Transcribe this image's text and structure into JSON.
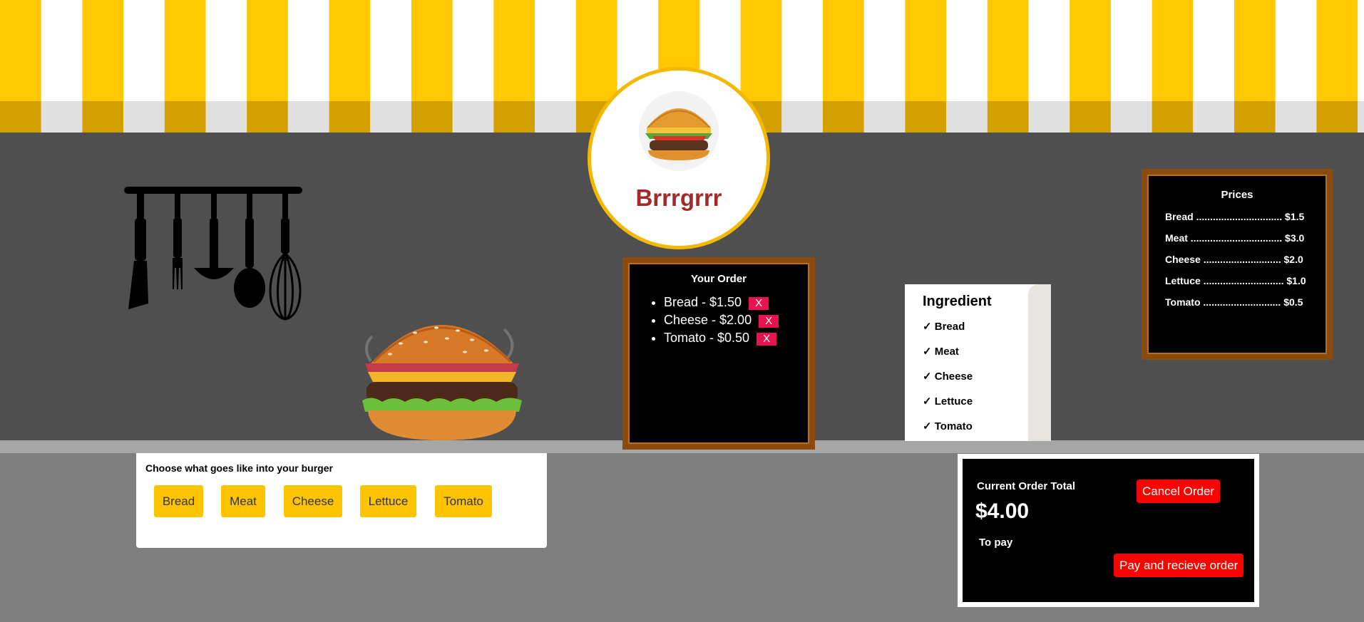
{
  "colors": {
    "awning_yellow": "#ffc800",
    "awning_dark": "#d4a000",
    "accent_red": "#ff0000",
    "frame_brown": "#8b4a0e",
    "button_yellow": "#ffc400"
  },
  "logo": {
    "name": "Brrrgrrr",
    "icon": "burger-icon"
  },
  "order_board": {
    "title": "Your Order",
    "items": [
      {
        "label": "Bread - $1.50",
        "remove": "X"
      },
      {
        "label": "Cheese - $2.00",
        "remove": "X"
      },
      {
        "label": "Tomato - $0.50",
        "remove": "X"
      }
    ]
  },
  "prices_board": {
    "title": "Prices",
    "rows": [
      {
        "text": "Bread ............................... $1.5"
      },
      {
        "text": "Meat ................................. $3.0"
      },
      {
        "text": "Cheese ............................ $2.0"
      },
      {
        "text": "Lettuce ............................. $1.0"
      },
      {
        "text": "Tomato ............................ $0.5"
      }
    ]
  },
  "receipt": {
    "title": "Ingredient",
    "items": [
      "✓ Bread",
      "✓ Meat",
      "✓ Cheese",
      "✓ Lettuce",
      "✓ Tomato"
    ]
  },
  "picker": {
    "title": "Choose what goes like into your burger",
    "buttons": [
      "Bread",
      "Meat",
      "Cheese",
      "Lettuce",
      "Tomato"
    ]
  },
  "total_panel": {
    "label": "Current Order Total",
    "amount": "$4.00",
    "to_pay": "To pay",
    "cancel": "Cancel Order",
    "pay": "Pay and recieve order"
  }
}
